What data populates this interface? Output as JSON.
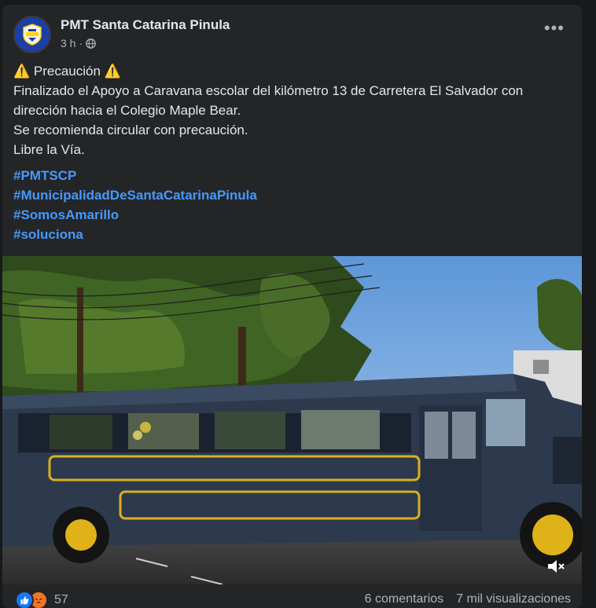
{
  "post": {
    "page_name": "PMT Santa Catarina Pinula",
    "time": "3 h",
    "separator": "·",
    "privacy_icon": "globe-icon",
    "more_icon": "more-options-icon",
    "text_lines": [
      "⚠️ Precaución ⚠️",
      "Finalizado el Apoyo a Caravana escolar del kilómetro 13 de Carretera El Salvador con",
      "dirección hacia el Colegio Maple Bear.",
      "Se recomienda circular con precaución.",
      "Libre la Vía."
    ],
    "hashtags": [
      "#PMTSCP",
      "#MunicipalidadDeSantaCatarinaPinula",
      "#SomosAmarillo",
      "#soluciona"
    ]
  },
  "video": {
    "mute_icon": "volume-muted-icon"
  },
  "footer": {
    "reaction_icons": [
      "like-reaction-icon",
      "angry-reaction-icon"
    ],
    "reaction_count": "57",
    "comments": "6 comentarios",
    "views": "7 mil visualizaciones"
  },
  "colors": {
    "background": "#18191a",
    "card": "#242526",
    "text": "#e4e6eb",
    "secondary_text": "#b0b3b8",
    "hashtag": "#4599ff",
    "like_blue": "#1877f2",
    "angry_orange": "#f27424"
  }
}
